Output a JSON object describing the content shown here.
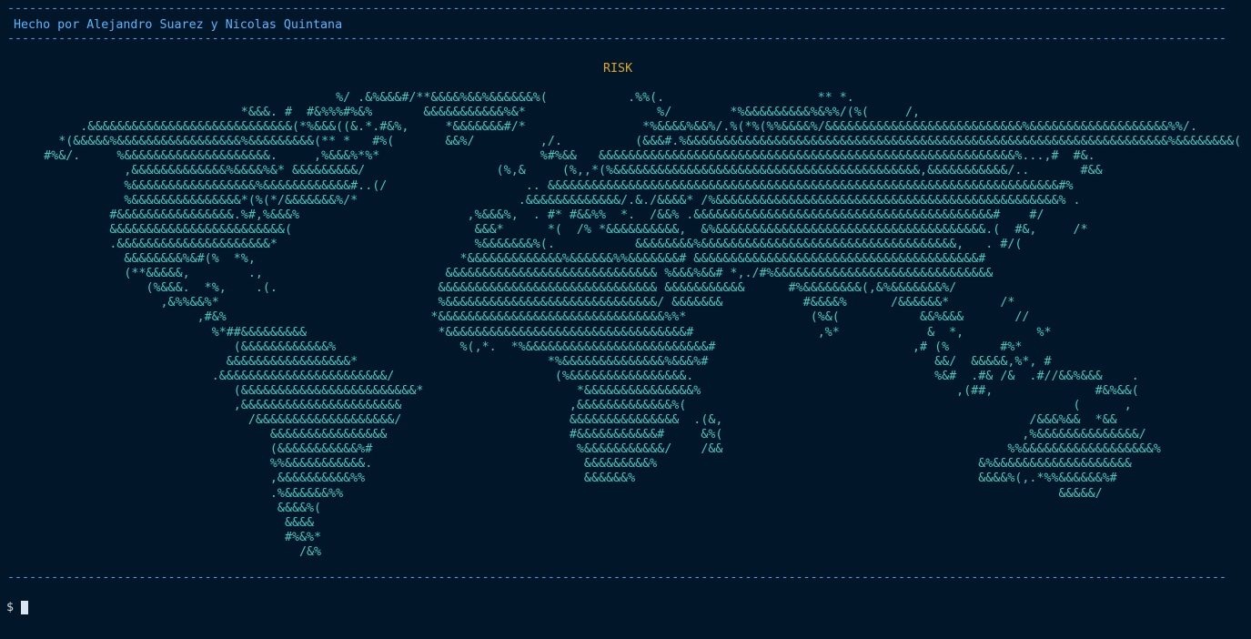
{
  "terminal": {
    "separator": "------------------------------------------------------------------------------------------------------------------------------------------------------------------------------------------------------------------------------------------------------------------",
    "credit": "Hecho por Alejandro Suarez y Nicolas Quintana",
    "title": "RISK",
    "map_ascii": "                                              %/ .&%&&&#/**&&&&%&&%&&&&&&%(           .%%(.                     ** *.\n                                 *&&&. #  #&%%%#%&%       &&&&&&&&&&&%&*                  %/        *%&&&&&&&&&%&%%/(%(     /,\n           .&&&&&&&&&&&&&&&&&&&&&&&&&&&&(*%&&&((&.*.#&%,     *&&&&&&&#/*                *%&&&&%&&%/.%(*%(%%&&&&%/&&&&&&&&&&&&&&&&&&&&&&&&&&&%&&&&&&&&&&&&&&&&&&&%%/.\n        *(&&&&&%&&&&&&&&&&&&&&&&&%&&&&&&&&&(** *   #%(       &&%/         ,/.          (&&&#.%&&&&&&&&&&&&&&&&&&&&&&&&&&&&&&&&&&&&&&&&&&&&&&&&&&&&&&&&&&&&&&&&&&%&&&&&&&&(  .\n      #%&/.     %&&&&&&&&&&&&&&&&&&&&.     ,%&&&%*%*                      %#%&&   &&&&&&&&&&&&&&&&&&&&&&&&&&&&&&&&&&&&&&&&&&&&&&&&&&&&&&&&&%...,#  #&.\n                 ,&&&&&&&&&&&&&%&&&&%&* &&&&&&&&&/                  (%,&     (%,,*(%&&&&&&&&&&&&&&&&&&&&&&&&&&&&&&&&&&&&&&&&&&,&&&&&&&&&&&/..       #&&\n                 %&&&&&&&&&&&&&&&&&%&&&&&&&&&&&&#..(/                   .. &&&&&&&&&&&&&&&&&&&&&&&&&&&&&&&&&&&&&&&&&&&&&&&&&&&&&&&&&&&&&&&&&&&&&&#%\n                 %&&&&&&&&&&&&&&&*(%(*/&&&&&&&%/*                      .&&&&&&&&&&&&&/.&./&&&&* /%&&&&&&&&&&&&&&&&&&&&&&&&&&&&&&&&&&&&&&&&&&&&&&&% .\n               #&&&&&&&&&&&&&&&&.%#,%&&&%                       ,%&&&%,  . #* #&&%%  *.  /&&% .&&&&&&&&&&&&&&&&&&&&&&&&&&&&&&&&&&&&&&&&&#    #/\n               &&&&&&&&&&&&&&&&&&&&&&&&(                         &&&*      *(  /% *&&&&&&&&&&,  &%&&&&&&&&&&&&&&&&&&&&&&&&&&&&&&&&&&&&&.(  #&,     /*\n               .&&&&&&&&&&&&&&&&&&&&&*                           %&&&&&&&%(.           &&&&&&&&%&&&&&&&&&&&&&&&&&&&&&&&&&&&&&&&&&&&,   . #/(\n                 &&&&&&&&%&#(%  *%,                            *&&&&&&&&&&&&&%&&&&&&%%&&&&&&&# &&&&&&&&&&&&&&&&&&&&&&&&&&&&&&&&&&&&&&&#\n                 (**&&&&&,        .,                         &&&&&&&&&&&&&&&&&&&&&&&&&&&&& %&&&%&&# *,./#%&&&&&&&&&&&&&&&&&&&&&&&&&&&&&&\n                    (%&&&.  *%,    .(.                      &&&&&&&&&&&&&&&&&&&&&&&&&&&&&& &&&&&&&&&&&      #%&&&&&&&&(,&%&&&&&&&%/\n                      ,&%%&&%*                              %&&&&&&&&&&&&&&&&&&&&&&&&&&&&&/ &&&&&&&           #&&&&%      /&&&&&&*       /*\n                           ,#&%                            *&&&&&&&&&&&&&&&&&&&&&&&&&&&&&&&%%*                 (%&(           &&%&&&       //\n                             %*##&&&&&&&&&                  *&&&&&&&&&&&&&&&&&&&&&&&&&&&&&&&&&#                 ,%*            &  *,          %*\n                                (&&&&&&&&&&&&%                 %(,*.  *%&&&&&&&&&&&&&&&&&&&&&&&&&#                           ,# (%       #%*\n                               &&&&&&&&&&&&&&&&&*                          *%&&&&&&&&&&&&&&%&&&%#                               &&/  &&&&&,%*, #\n                             .&&&&&&&&&&&&&&&&&&&&&&&/                      (%&&&&&&&&&&&&&&&&.                                 %&#  .#& /&  .#//&&%&&&    .\n                                (&&&&&&&&&&&&&&&&&&&&&&&&*                     *&&&&&&&&&&&&&&&%                                   ,(##,              #&%&&(\n                                ,&&&&&&&&&&&&&&&&&&&&&&                       ,&&&&&&&&&&&&&%(                                                     (      ,\n                                  /&&&&&&&&&&&&&&&&&&&/                       &&&&&&&&&&&&&&&  .(&,                                          /&&&%&&  *&&\n                                     &&&&&&&&&&&&&&&&                         #&&&&&&&&&&&#     &%(                                         ,%&&&&&&&&&&&&&&/\n                                     (&&&&&&&&&&&%#                            %&&&&&&&&&&&/    /&&                                       %%&&&&&&&&&&&&&&&&&&%\n                                     %%&&&&&&&&&&&.                             &&&&&&&&&%                                            &%&&&&&&&&&&&&&&&&&&&\n                                     ,&&&&&&&&&&%%                              &&&&&&%                                               &&&&%(,.*%%&&&&&&%#\n                                     .%&&&&&&%%                                                                                                  &&&&&/\n                                      &&&&%(\n                                       &&&&\n                                       #%&%*\n                                         /&%",
    "prompt_symbol": "$"
  },
  "colors": {
    "background": "#021629",
    "separator": "#3aa6e6",
    "credit": "#58b6ff",
    "title": "#d7a62a",
    "map": "#45c8c0"
  }
}
